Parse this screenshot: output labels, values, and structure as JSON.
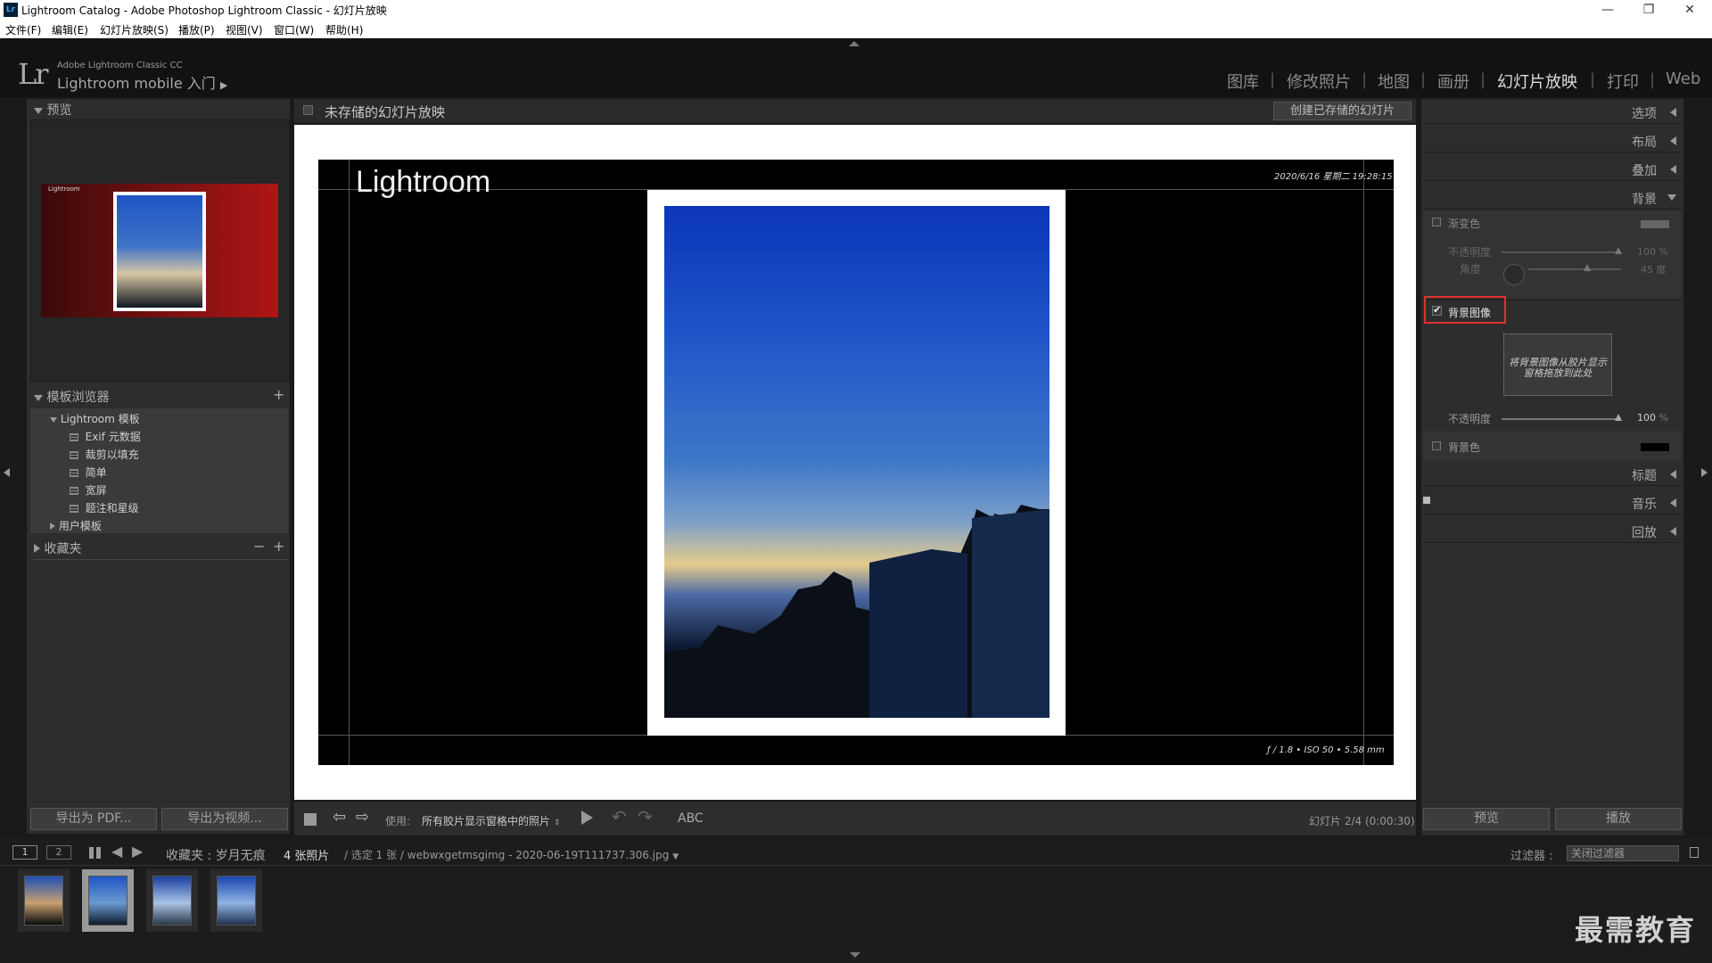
{
  "window": {
    "title": "Lightroom Catalog - Adobe Photoshop Lightroom Classic - 幻灯片放映",
    "app_icon": "Lr",
    "controls": {
      "minimize": "—",
      "maximize": "❐",
      "close": "✕"
    }
  },
  "menu": [
    "文件(F)",
    "编辑(E)",
    "幻灯片放映(S)",
    "播放(P)",
    "视图(V)",
    "窗口(W)",
    "帮助(H)"
  ],
  "identity": {
    "logo": "Lr",
    "sub": "Adobe Lightroom Classic CC",
    "mobile": "Lightroom mobile 入门",
    "arrow": "▶"
  },
  "modules": [
    {
      "label": "图库",
      "active": false
    },
    {
      "label": "修改照片",
      "active": false
    },
    {
      "label": "地图",
      "active": false
    },
    {
      "label": "画册",
      "active": false
    },
    {
      "label": "幻灯片放映",
      "active": true
    },
    {
      "label": "打印",
      "active": false
    },
    {
      "label": "Web",
      "active": false
    }
  ],
  "left_panel": {
    "preview_header": "预览",
    "preview_thumb_title": "Lightroom",
    "template_header": "模板浏览器",
    "template_add": "+",
    "lightroom_templates": "Lightroom 模板",
    "templates": [
      "Exif 元数据",
      "裁剪以填充",
      "简单",
      "宽屏",
      "题注和星级"
    ],
    "user_templates": "用户模板",
    "collections_header": "收藏夹",
    "collections_minus": "−",
    "collections_plus": "+",
    "export_pdf": "导出为 PDF...",
    "export_video": "导出为视频..."
  },
  "center": {
    "slideshow_title": "未存储的幻灯片放映",
    "create_saved": "创建已存储的幻灯片",
    "slide_title": "Lightroom",
    "slide_date": "2020/6/16 星期二  19:28:15",
    "slide_exif": "ƒ / 1.8 • ISO 50 • 5.58 mm"
  },
  "toolbar": {
    "use_label": "使用:",
    "use_value": "所有胶片显示窗格中的照片",
    "abc": "ABC",
    "slide_counter": "幻灯片 2/4 (0:00:30)"
  },
  "right_panel": {
    "sections": {
      "options": "选项",
      "layout": "布局",
      "overlay": "叠加",
      "backdrop": "背景",
      "titles": "标题",
      "music": "音乐",
      "playback": "回放"
    },
    "gradient": "渐变色",
    "opacity": "不透明度",
    "opacity_value": "100",
    "angle": "角度",
    "angle_value": "45",
    "angle_unit": "度",
    "percent": "%",
    "bg_image": "背景图像",
    "bg_image_hint": "将背景图像从胶片显示窗格拖放到此处",
    "bg_opacity": "不透明度",
    "bg_opacity_value": "100",
    "bg_color": "背景色",
    "preview_btn": "预览",
    "play_btn": "播放"
  },
  "filmstrip": {
    "view1": "1",
    "view2": "2",
    "source": "收藏夹 : 岁月无痕",
    "count": "4 张照片",
    "selected": "/ 选定 1 张 / webwxgetmsgimg - 2020-06-19T111737.306.jpg",
    "filter_label": "过滤器 :",
    "filter_value": "关闭过滤器"
  },
  "watermark": "最需教育",
  "colors": {
    "highlight": "#e03030",
    "accent_red": "#b01515"
  }
}
